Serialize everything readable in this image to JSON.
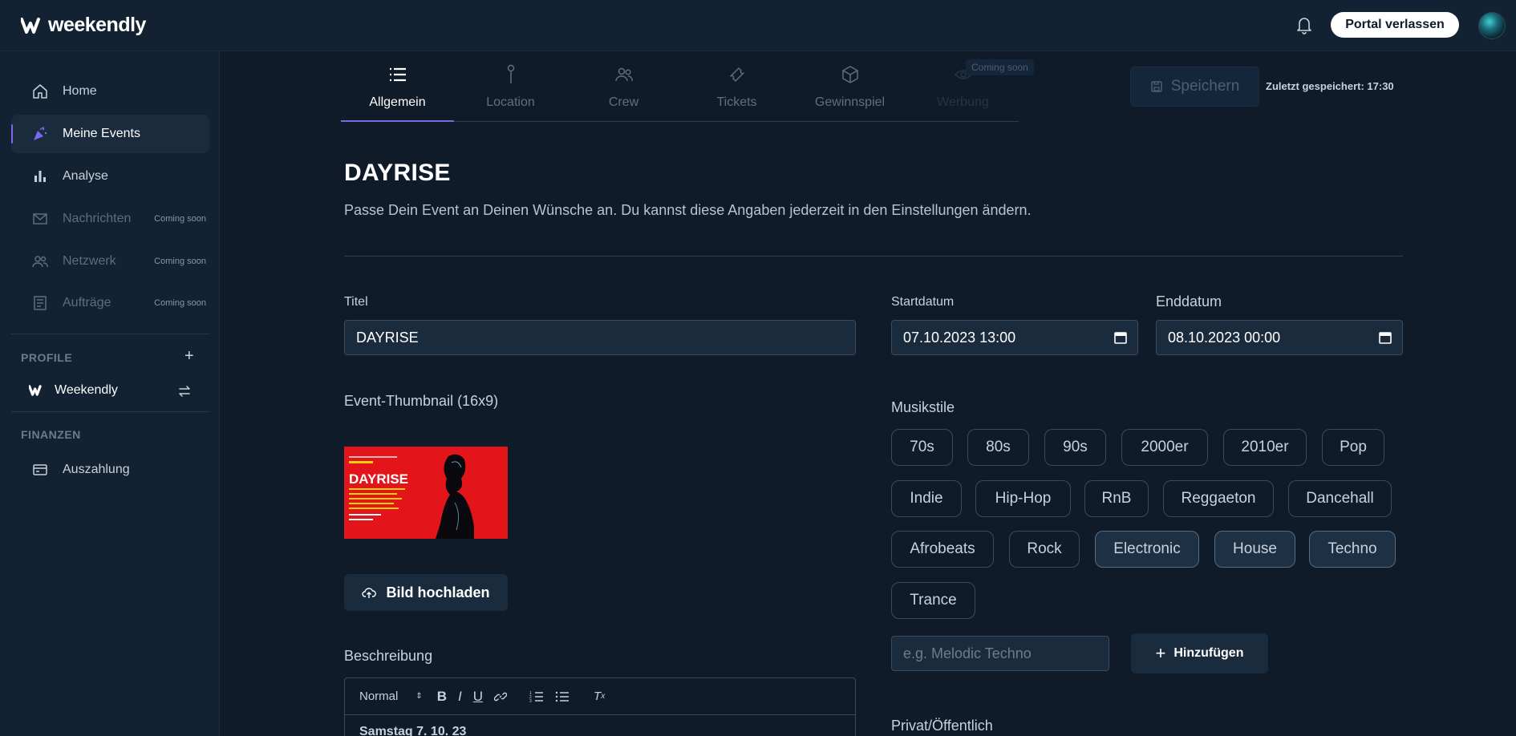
{
  "app": {
    "brand": "weekendly"
  },
  "header": {
    "portal_button": "Portal verlassen"
  },
  "sidebar": {
    "items": [
      {
        "label": "Home",
        "icon": "home-icon"
      },
      {
        "label": "Meine Events",
        "icon": "party-popper-icon",
        "active": true
      },
      {
        "label": "Analyse",
        "icon": "bar-chart-icon"
      },
      {
        "label": "Nachrichten",
        "icon": "mail-icon",
        "badge": "Coming soon"
      },
      {
        "label": "Netzwerk",
        "icon": "users-icon",
        "badge": "Coming soon"
      },
      {
        "label": "Aufträge",
        "icon": "document-icon",
        "badge": "Coming soon"
      }
    ],
    "profile_heading": "PROFILE",
    "profile_name": "Weekendly",
    "finance_heading": "FINANZEN",
    "finance_item": "Auszahlung"
  },
  "tabs": [
    {
      "label": "Allgemein",
      "icon": "list-icon",
      "active": true
    },
    {
      "label": "Location",
      "icon": "pin-icon"
    },
    {
      "label": "Crew",
      "icon": "crew-icon"
    },
    {
      "label": "Tickets",
      "icon": "ticket-icon"
    },
    {
      "label": "Gewinnspiel",
      "icon": "box-icon"
    },
    {
      "label": "Werbung",
      "icon": "eye-icon",
      "badge": "Coming soon"
    }
  ],
  "toolbar": {
    "save_label": "Speichern",
    "last_saved": "Zuletzt gespeichert: 17:30"
  },
  "event": {
    "title": "DAYRISE",
    "subtitle": "Passe Dein Event an Deinen Wünsche an. Du kannst diese Angaben jederzeit in den Einstellungen ändern.",
    "title_label": "Titel",
    "title_value": "DAYRISE",
    "start_label": "Startdatum",
    "start_value": "07.10.2023 13:00",
    "end_label": "Enddatum",
    "end_value": "08.10.2023 00:00",
    "thumb_label": "Event-Thumbnail (16x9)",
    "thumb_text": "DAYRISE",
    "upload_label": "Bild hochladen",
    "description_label": "Beschreibung",
    "editor_format": "Normal",
    "editor_first_line": "Samstag 7. 10. 23",
    "music_label": "Musikstile",
    "music_styles": [
      {
        "label": "70s",
        "selected": false
      },
      {
        "label": "80s",
        "selected": false
      },
      {
        "label": "90s",
        "selected": false
      },
      {
        "label": "2000er",
        "selected": false
      },
      {
        "label": "2010er",
        "selected": false
      },
      {
        "label": "Pop",
        "selected": false
      },
      {
        "label": "Indie",
        "selected": false
      },
      {
        "label": "Hip-Hop",
        "selected": false
      },
      {
        "label": "RnB",
        "selected": false
      },
      {
        "label": "Reggaeton",
        "selected": false
      },
      {
        "label": "Dancehall",
        "selected": false
      },
      {
        "label": "Afrobeats",
        "selected": false
      },
      {
        "label": "Rock",
        "selected": false
      },
      {
        "label": "Electronic",
        "selected": true
      },
      {
        "label": "House",
        "selected": true
      },
      {
        "label": "Techno",
        "selected": true
      },
      {
        "label": "Trance",
        "selected": false
      }
    ],
    "music_placeholder": "e.g. Melodic Techno",
    "add_label": "Hinzufügen",
    "privacy_label": "Privat/Öffentlich"
  },
  "colors": {
    "background": "#0f1b29",
    "panel": "#132232",
    "accent": "#7b68ee",
    "text": "#e6edf5"
  }
}
